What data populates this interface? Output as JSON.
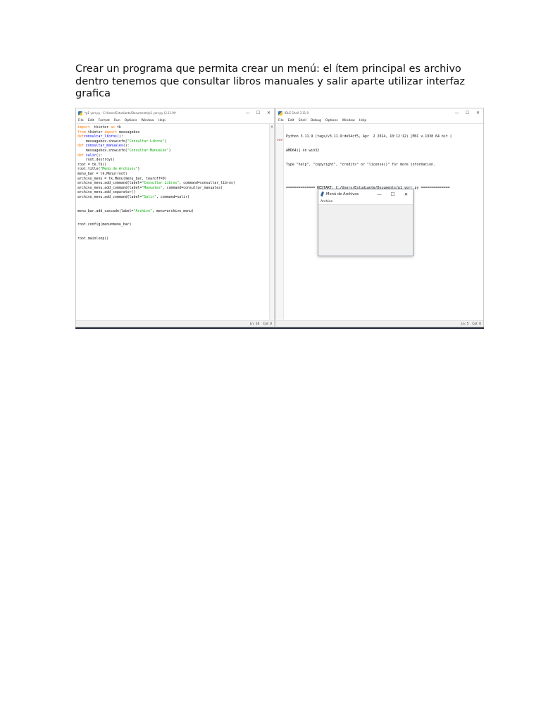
{
  "heading": "Crear un programa que permita crear un menú: el ítem principal es archivo dentro tenemos que consultar libros manuales y salir aparte utilizar interfaz grafica",
  "editor": {
    "title": "*p1 yorr.py - C:/Users/Estudiante/Documents/p1 yorr.py (3.11.9)*",
    "menu": [
      "File",
      "Edit",
      "Format",
      "Run",
      "Options",
      "Window",
      "Help"
    ],
    "code_lines": [
      [
        [
          "kw",
          "import"
        ],
        [
          "",
          "  tkinter "
        ],
        [
          "kw",
          "as"
        ],
        [
          "",
          " tk"
        ]
      ],
      [
        [
          "kw",
          "from"
        ],
        [
          "",
          " tkinter "
        ],
        [
          "kw",
          "import"
        ],
        [
          "",
          " messagebox"
        ]
      ],
      [
        [
          "kw",
          "def"
        ],
        [
          " ",
          ""
        ],
        [
          "fn",
          "consultar_libros"
        ],
        [
          "",
          "():"
        ]
      ],
      [
        [
          "",
          "    messagebox.showinfo("
        ],
        [
          "st",
          "\"Consultar Libros\""
        ],
        [
          "",
          ")"
        ]
      ],
      [
        [
          "kw",
          "def"
        ],
        [
          "",
          " "
        ],
        [
          "fn",
          "consultar_manuales"
        ],
        [
          "",
          "():"
        ]
      ],
      [
        [
          "",
          "    messagebox.showinfo("
        ],
        [
          "st",
          "\"Consultar Manuales\""
        ],
        [
          "",
          ")"
        ]
      ],
      [
        [
          "kw",
          "def"
        ],
        [
          "",
          " "
        ],
        [
          "fn",
          "salir"
        ],
        [
          "",
          "():"
        ]
      ],
      [
        [
          "",
          "    root.destroy()"
        ]
      ],
      [
        [
          "",
          "root = tk.Tk()"
        ]
      ],
      [
        [
          "",
          "root.title("
        ],
        [
          "st",
          "\"Menú de Archivos\""
        ],
        [
          "",
          ")"
        ]
      ],
      [
        [
          "",
          "menu_bar = tk.Menu(root)"
        ]
      ],
      [
        [
          "",
          "archivo_menu = tk.Menu(menu_bar, tearoff=0)"
        ]
      ],
      [
        [
          "",
          "archivo_menu.add_command(label="
        ],
        [
          "st",
          "\"Consultar Libros\""
        ],
        [
          "",
          ", command=consultar_libros)"
        ]
      ],
      [
        [
          "",
          "archivo_menu.add_command(label="
        ],
        [
          "st",
          "\"Manuales\""
        ],
        [
          "",
          ", command=consultar_manuales)"
        ]
      ],
      [
        [
          "",
          "archivo_menu.add_separator()"
        ]
      ],
      [
        [
          "",
          "archivo_menu.add_command(label="
        ],
        [
          "st",
          "\"Salir\""
        ],
        [
          "",
          ", command=salir)"
        ]
      ],
      [
        [
          "",
          ""
        ]
      ],
      [
        [
          "",
          ""
        ]
      ],
      [
        [
          "",
          "menu_bar.add_cascade(label="
        ],
        [
          "st",
          "\"Archivo\""
        ],
        [
          "",
          ", menu=archivo_menu)"
        ]
      ],
      [
        [
          "",
          ""
        ]
      ],
      [
        [
          "",
          ""
        ]
      ],
      [
        [
          "",
          "root.config(menu=menu_bar)"
        ]
      ],
      [
        [
          "",
          ""
        ]
      ],
      [
        [
          "",
          ""
        ]
      ],
      [
        [
          "",
          "root.mainloop()"
        ]
      ]
    ],
    "status_ln": "Ln: 16",
    "status_col": "Col: 0"
  },
  "shell": {
    "title": "IDLE Shell 3.11.9",
    "menu": [
      "File",
      "Edit",
      "Shell",
      "Debug",
      "Options",
      "Window",
      "Help"
    ],
    "prompt": ">>>",
    "output_lines": [
      "Python 3.11.9 (tags/v3.11.9:de54cf5, Apr  2 2024, 10:12:12) [MSC v.1938 64 bit (",
      "AMD64)] on win32",
      "Type \"help\", \"copyright\", \"credits\" or \"license()\" for more information.",
      "",
      "============== RESTART: C:/Users/Estudiante/Documents/p1 yorr.py =============="
    ],
    "status_ln": "Ln: 5",
    "status_col": "Col: 0"
  },
  "popup": {
    "title": "Menú de Archivos",
    "menu_item": "Archivo"
  },
  "window_controls": {
    "minimize": "—",
    "maximize": "☐",
    "close": "✕"
  },
  "colors": {
    "keyword": "#ff7700",
    "function_name": "#0000ff",
    "string": "#00aa00"
  }
}
